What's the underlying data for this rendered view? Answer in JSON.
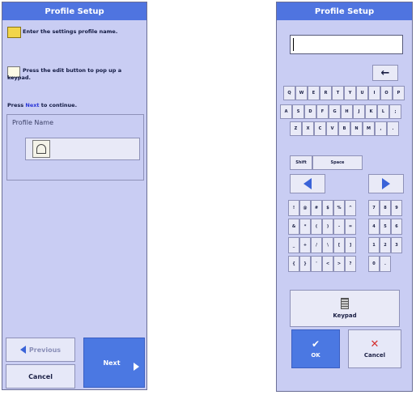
{
  "left": {
    "title": "Profile Setup",
    "instruction_1": "Enter the settings profile name.",
    "instruction_2": "Press the edit button to pop up a keypad.",
    "instruction_3_prefix": "Press ",
    "instruction_3_link": "Next",
    "instruction_3_suffix": " to continue.",
    "field_label": "Profile Name",
    "field_value": "",
    "previous_label": "Previous",
    "next_label": "Next",
    "cancel_label": "Cancel"
  },
  "right": {
    "title": "Profile Setup",
    "input_value": "",
    "backspace_glyph": "←",
    "row_qwerty": [
      "Q",
      "W",
      "E",
      "R",
      "T",
      "Y",
      "U",
      "I",
      "O",
      "P"
    ],
    "row_asdf": [
      "A",
      "S",
      "D",
      "F",
      "G",
      "H",
      "J",
      "K",
      "L",
      ";"
    ],
    "row_zxcv": [
      "Z",
      "X",
      "C",
      "V",
      "B",
      "N",
      "M",
      ",",
      "."
    ],
    "shift_label": "Shift",
    "space_label": "Space",
    "sym_rows": [
      [
        "!",
        "@",
        "#",
        "$",
        "%",
        "^"
      ],
      [
        "&",
        "*",
        "(",
        ")",
        "-",
        "="
      ],
      [
        "_",
        "+",
        "/",
        "\\",
        "[",
        "]"
      ],
      [
        "{",
        "}",
        "'",
        "<",
        ">",
        "?"
      ]
    ],
    "num_rows": [
      [
        "7",
        "8",
        "9"
      ],
      [
        "4",
        "5",
        "6"
      ],
      [
        "1",
        "2",
        "3"
      ],
      [
        "0",
        "."
      ]
    ],
    "keypad_label": "Keypad",
    "ok_label": "OK",
    "cancel_label": "Cancel"
  }
}
